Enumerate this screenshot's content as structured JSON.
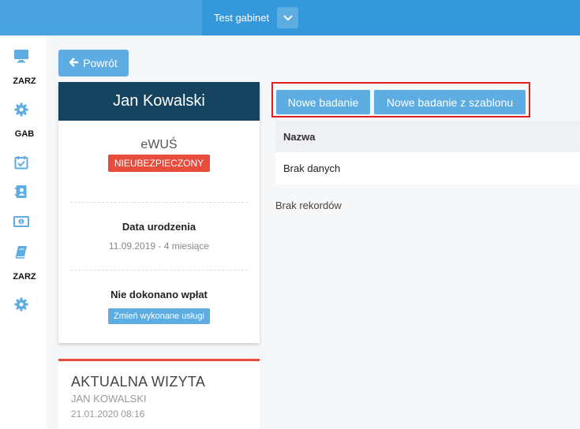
{
  "topbar": {
    "clinic_name": "Test gabinet",
    "dropdown_icon": "chevron-down-icon"
  },
  "sidebar": {
    "items": [
      {
        "icon": "monitor-icon"
      },
      {
        "label": "ZARZ"
      },
      {
        "icon": "gear-icon"
      },
      {
        "label": "GAB"
      },
      {
        "icon": "calendar-check-icon"
      },
      {
        "icon": "contact-book-icon"
      },
      {
        "icon": "money-icon"
      },
      {
        "icon": "book-icon"
      },
      {
        "label": "ZARZ"
      },
      {
        "icon": "gear-icon"
      }
    ]
  },
  "back_button": {
    "label": "Powrót"
  },
  "patient": {
    "name": "Jan Kowalski",
    "ewus_label": "eWUŚ",
    "ewus_status": "NIEUBEZPIECZONY",
    "dob_title": "Data urodzenia",
    "dob_value": "11.09.2019 - 4 miesiące",
    "payments_title": "Nie dokonano wpłat",
    "change_services_button": "Zmień wykonane usługi"
  },
  "visit": {
    "title": "AKTUALNA WIZYTA",
    "patient_name": "JAN KOWALSKI",
    "datetime": "21.01.2020 08:16"
  },
  "actions": {
    "new_exam": "Nowe badanie",
    "new_exam_template": "Nowe badanie z szablonu"
  },
  "table": {
    "columns": [
      "Nazwa"
    ],
    "rows": [
      "Brak danych"
    ],
    "empty_text": "Brak rekordów"
  },
  "colors": {
    "topbar": "#3498db",
    "accent": "#5dade2",
    "header_dark": "#154360",
    "danger": "#e74c3c",
    "icon_blue": "#5dade2"
  }
}
